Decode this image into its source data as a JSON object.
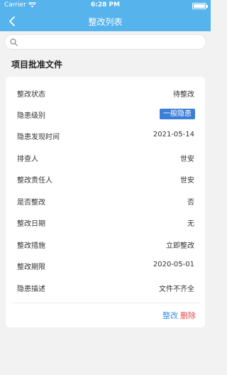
{
  "status_bar": {
    "carrier": "Carrier",
    "time": "6:28 PM",
    "battery_level": 1.0
  },
  "nav": {
    "title": "整改列表"
  },
  "search": {
    "value": "",
    "placeholder": ""
  },
  "section": {
    "title": "项目批准文件"
  },
  "details": [
    {
      "label": "整改状态",
      "value": "待整改"
    },
    {
      "label": "隐患级别",
      "value": "一般隐患"
    },
    {
      "label": "隐患发现时间",
      "value": "2021-05-14"
    },
    {
      "label": "排查人",
      "value": "世安"
    },
    {
      "label": "整改责任人",
      "value": "世安"
    },
    {
      "label": "是否整改",
      "value": "否"
    },
    {
      "label": "整改日期",
      "value": "无"
    },
    {
      "label": "整改措施",
      "value": "立即整改"
    },
    {
      "label": "整改期限",
      "value": "2020-05-01"
    },
    {
      "label": "隐患描述",
      "value": "文件不齐全"
    }
  ],
  "actions": {
    "edit": "整改",
    "delete": "删除"
  },
  "colors": {
    "header": "#56b3ec",
    "tag": "#3d7fd6",
    "edit": "#3d8fe0",
    "delete": "#e34b4b"
  }
}
